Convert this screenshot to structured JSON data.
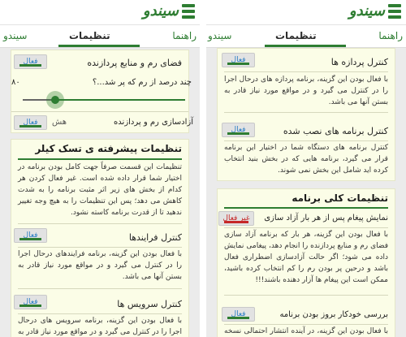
{
  "app": {
    "name": "سیندو"
  },
  "colors": {
    "accent": "#2e7d32",
    "card_bg": "#fbfde7",
    "screen_bg": "#ebebeb",
    "link": "#2b7ec4",
    "off": "#c62828"
  },
  "left_screen": {
    "tabs": [
      "راهنما",
      "تنظیمات",
      "سیندو"
    ],
    "memory_card": {
      "title": "فضای رم و منابع پردازنده",
      "toggle": "فعال",
      "question": "چند درصد از رم که پر شد...؟",
      "value_label": "۸٠",
      "slider_value": 0.8,
      "footer_title": "آزادسازی رم و پردازنده",
      "footer_partial": "هش",
      "footer_toggle": "فعال"
    },
    "advanced_card": {
      "title": "تنظیمات پیشرفته ی تسک کیلر",
      "description": "تنظیمات این قسمت صرفاً جهت کامل بودن برنامه در اختیار شما قرار داده شده است. غیر فعال کردن هر کدام از بخش های زیر اثر مثبت برنامه را به شدت کاهش می دهد؛ پس این تنظیمات را به هیچ وجه تغییر ندهید تا از قدرت برنامه کاسته نشود.",
      "items": [
        {
          "title": "کنترل فرایندها",
          "toggle": "فعال",
          "description": "با فعال بودن این گزینه، برنامه فرایندهای درحال اجرا را در کنترل می گیرد و در مواقع مورد نیاز قادر به بستن آنها می باشد."
        },
        {
          "title": "کنترل سرویس ها",
          "toggle": "فعال",
          "description": "با فعال بودن این گزینه، برنامه سرویس های درحال اجرا را در کنترل می گیرد و در مواقع مورد نیاز قادر به بستن"
        }
      ]
    }
  },
  "right_screen": {
    "tabs": [
      "راهنما",
      "تنظیمات",
      "سیندو"
    ],
    "card1": {
      "items": [
        {
          "title": "کنترل پردازه ها",
          "toggle": "فعال",
          "description": "با فعال بودن این گزینه، برنامه پردازه های درحال اجرا را در کنترل می گیرد و در مواقع مورد نیاز قادر به بستن آنها می باشد."
        },
        {
          "title": "کنترل برنامه های نصب شده",
          "toggle": "فعال",
          "description": "کنترل برنامه های دستگاه شما در اختیار این برنامه قرار می گیرد، برنامه هایی که در بخش بنید انتخاب کرده اید شامل این بخش نمی شوند."
        }
      ]
    },
    "card2": {
      "title": "تنظیمات کلی برنامه",
      "items": [
        {
          "title": "نمایش پیغام پس از هر بار آزاد سازی",
          "toggle": "غیر فعال",
          "description": "با فعال بودن این گزینه، هر بار که برنامه آزاد سازی فضای رم و منابع پردازنده را انجام دهد، پیغامی نمایش داده می شود؛ اگر حالت آزادسازی اضطراری فعال باشد و درحین پر بودن رم را کم انتخاب کرده باشید، ممکن است این پیغام ها آزار دهنده باشند!!!"
        },
        {
          "title": "بررسی خودکار بروز بودن برنامه",
          "toggle": "فعال",
          "description": "با فعال بودن این گزینه، در آینده انتشار احتمالی نسخه ی"
        }
      ]
    }
  }
}
